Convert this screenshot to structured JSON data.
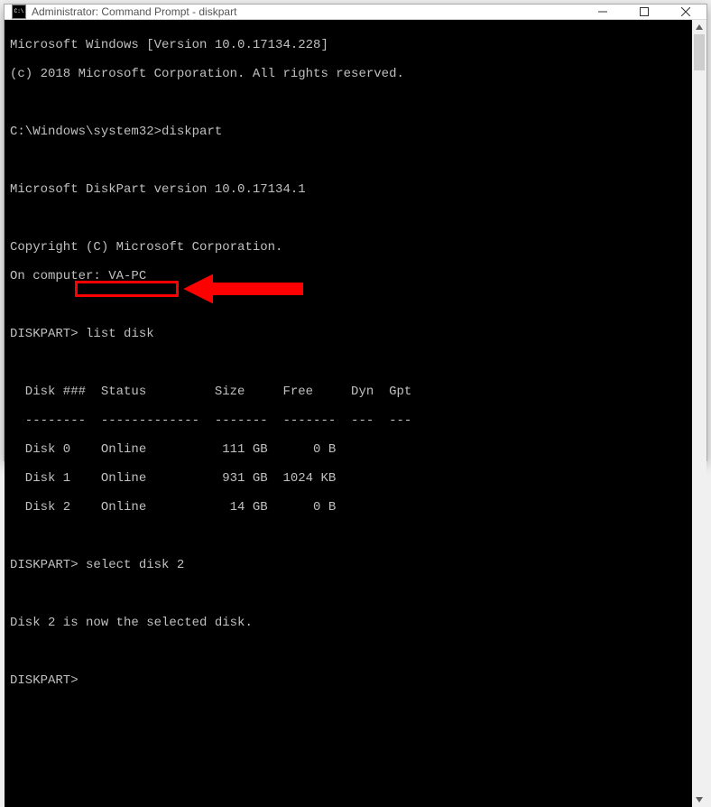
{
  "titlebar": {
    "text": "Administrator: Command Prompt - diskpart"
  },
  "console": {
    "header_line1": "Microsoft Windows [Version 10.0.17134.228]",
    "header_line2": "(c) 2018 Microsoft Corporation. All rights reserved.",
    "prompt1_path": "C:\\Windows\\system32>",
    "prompt1_cmd": "diskpart",
    "diskpart_version": "Microsoft DiskPart version 10.0.17134.1",
    "copyright": "Copyright (C) Microsoft Corporation.",
    "computer_line": "On computer: VA-PC",
    "diskpart_prompt": "DISKPART>",
    "cmd_list_disk": "list disk",
    "table_header": "  Disk ###  Status         Size     Free     Dyn  Gpt",
    "table_divider": "  --------  -------------  -------  -------  ---  ---",
    "disk_rows": [
      "  Disk 0    Online          111 GB      0 B",
      "  Disk 1    Online          931 GB  1024 KB",
      "  Disk 2    Online           14 GB      0 B"
    ],
    "cmd_select_disk": "select disk 2",
    "selected_msg": "Disk 2 is now the selected disk.",
    "final_prompt": "DISKPART>"
  },
  "annotation": {
    "highlighted_command": "select disk 2"
  }
}
